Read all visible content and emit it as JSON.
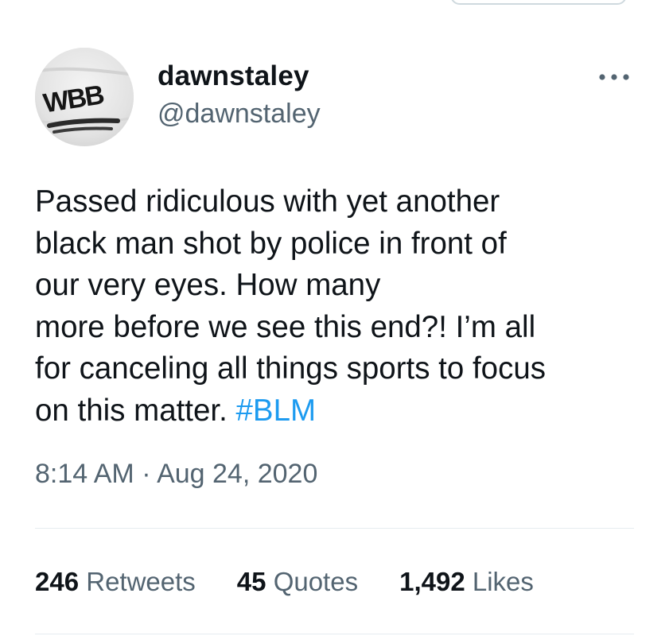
{
  "author": {
    "name": "dawnstaley",
    "handle": "@dawnstaley",
    "avatar_text": "WBB"
  },
  "tweet": {
    "lines": [
      "Passed ridiculous with yet another",
      "black man shot by police in front of",
      "our very eyes. How many",
      "more before we see this end?! I’m all",
      "for canceling all things sports to focus",
      "on this matter. "
    ],
    "hashtag": "#BLM",
    "timestamp": "8:14 AM · Aug 24, 2020"
  },
  "stats": {
    "retweets": {
      "count": "246",
      "label": "Retweets"
    },
    "quotes": {
      "count": "45",
      "label": "Quotes"
    },
    "likes": {
      "count": "1,492",
      "label": "Likes"
    }
  },
  "icons": {
    "more": "more-horizontal-icon"
  },
  "colors": {
    "hashtag": "#1d9bf0",
    "secondary_text": "#536471",
    "primary_text": "#0f1419"
  }
}
